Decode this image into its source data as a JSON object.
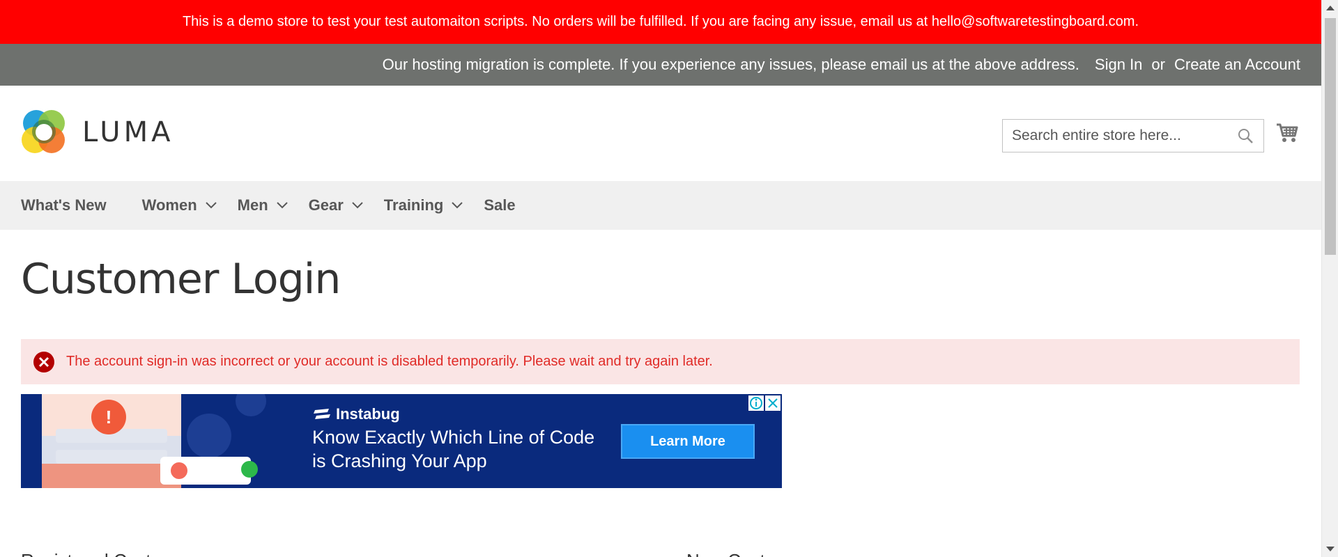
{
  "demo_notice": "This is a demo store to test your test automaiton scripts. No orders will be fulfilled. If you are facing any issue, email us at hello@softwaretestingboard.com.",
  "top_panel": {
    "notice": "Our hosting migration is complete. If you experience any issues, please email us at the above address.",
    "sign_in": "Sign In",
    "or": "or",
    "create_account": "Create an Account"
  },
  "header": {
    "logo_text": "LUMA",
    "search_placeholder": "Search entire store here..."
  },
  "nav": [
    {
      "label": "What's New"
    },
    {
      "label": "Women"
    },
    {
      "label": "Men"
    },
    {
      "label": "Gear"
    },
    {
      "label": "Training"
    },
    {
      "label": "Sale"
    }
  ],
  "main": {
    "page_title": "Customer Login",
    "error_message": "The account sign-in was incorrect or your account is disabled temporarily. Please wait and try again later."
  },
  "ad": {
    "brand": "Instabug",
    "headline_line1": "Know Exactly Which Line of Code",
    "headline_line2": "is Crashing Your App",
    "cta": "Learn More",
    "accent": "#1a8ff0",
    "background": "#0a2a7d"
  },
  "below": {
    "left": "Registered Customers",
    "right": "New Customers"
  },
  "colors": {
    "demo_bar": "#ff0000",
    "top_panel": "#6e716e",
    "nav_bg": "#f0f0f0",
    "error_bg": "#fae5e5",
    "error_text": "#e02b27"
  }
}
